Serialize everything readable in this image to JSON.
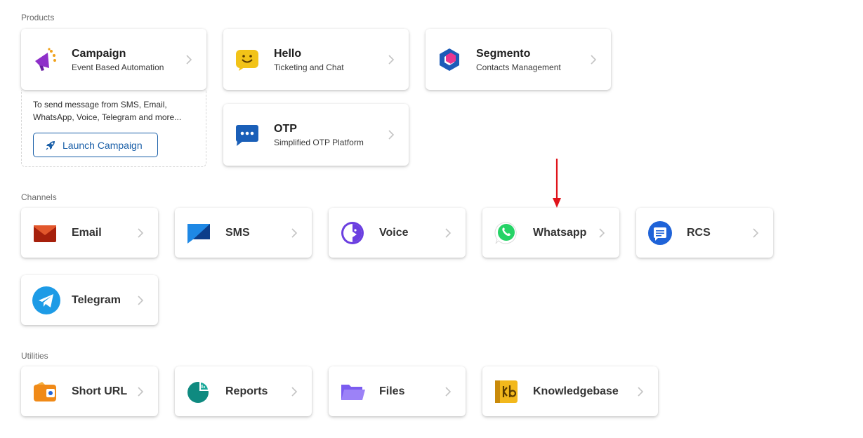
{
  "sections": {
    "products": "Products",
    "channels": "Channels",
    "utilities": "Utilities"
  },
  "products": {
    "campaign": {
      "title": "Campaign",
      "subtitle": "Event Based Automation",
      "icon": "megaphone-icon"
    },
    "hello": {
      "title": "Hello",
      "subtitle": "Ticketing and Chat",
      "icon": "smiley-chat-icon"
    },
    "segmento": {
      "title": "Segmento",
      "subtitle": "Contacts Management",
      "icon": "segmento-hexagon-icon"
    },
    "otp": {
      "title": "OTP",
      "subtitle": "Simplified OTP Platform",
      "icon": "otp-chat-icon"
    }
  },
  "campaign_extra": {
    "description": "To send message from SMS, Email, WhatsApp, Voice, Telegram and more...",
    "launch_label": "Launch Campaign"
  },
  "channels": [
    {
      "label": "Email",
      "icon": "email-icon"
    },
    {
      "label": "SMS",
      "icon": "sms-icon"
    },
    {
      "label": "Voice",
      "icon": "voice-icon"
    },
    {
      "label": "Whatsapp",
      "icon": "whatsapp-icon"
    },
    {
      "label": "RCS",
      "icon": "rcs-icon"
    },
    {
      "label": "Telegram",
      "icon": "telegram-icon"
    }
  ],
  "utilities": [
    {
      "label": "Short URL",
      "icon": "short-url-icon"
    },
    {
      "label": "Reports",
      "icon": "reports-icon"
    },
    {
      "label": "Files",
      "icon": "folder-icon"
    },
    {
      "label": "Knowledgebase",
      "icon": "knowledgebase-icon"
    }
  ],
  "colors": {
    "accent": "#1a5fa8",
    "annotation_arrow": "#e0141b"
  }
}
